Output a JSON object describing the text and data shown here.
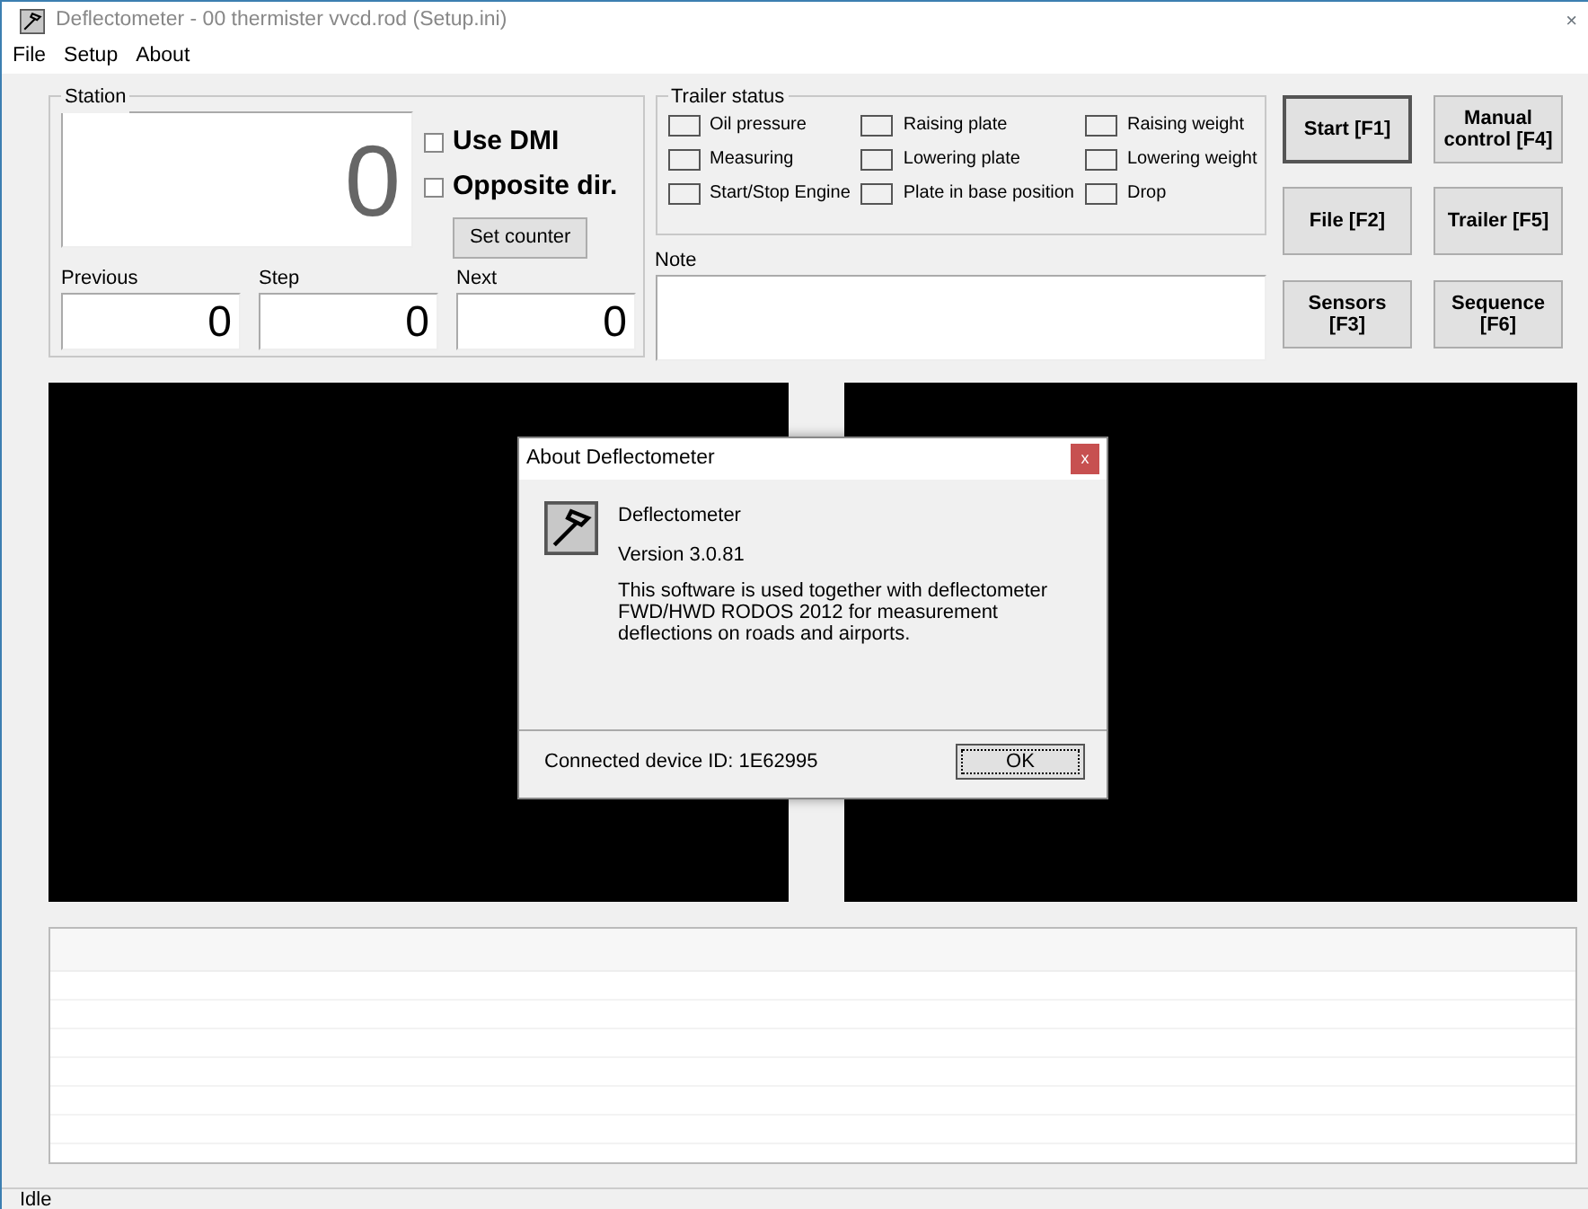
{
  "window": {
    "title": "Deflectometer - 00 thermister vvcd.rod (Setup.ini)",
    "close": "×"
  },
  "menu": [
    "File",
    "Setup",
    "About"
  ],
  "station": {
    "label": "Station",
    "value": "0",
    "options": [
      {
        "label": "Use DMI",
        "checked": false
      },
      {
        "label": "Opposite dir.",
        "checked": false
      }
    ],
    "set_button": "Set counter",
    "counters": [
      {
        "label": "Previous",
        "value": "0"
      },
      {
        "label": "Step",
        "value": "0"
      },
      {
        "label": "Next",
        "value": "0"
      }
    ]
  },
  "trailer_status": {
    "label": "Trailer status",
    "items": [
      {
        "label": "Oil pressure",
        "on": false
      },
      {
        "label": "Raising plate",
        "on": false
      },
      {
        "label": "Raising weight",
        "on": false
      },
      {
        "label": "Measuring",
        "on": false
      },
      {
        "label": "Lowering plate",
        "on": false
      },
      {
        "label": "Lowering weight",
        "on": false
      },
      {
        "label": "Start/Stop Engine",
        "on": false
      },
      {
        "label": "Plate in base position",
        "on": false
      },
      {
        "label": "Drop",
        "on": false
      }
    ]
  },
  "note": {
    "label": "Note"
  },
  "buttons": [
    {
      "label": "Start [F1]",
      "focused": true
    },
    {
      "label": "Manual control [F4]",
      "focused": false
    },
    {
      "label": "File [F2]",
      "focused": false
    },
    {
      "label": "Trailer [F5]",
      "focused": false
    },
    {
      "label": "Sensors [F3]",
      "focused": false
    },
    {
      "label": "Sequence [F6]",
      "focused": false
    }
  ],
  "dialog": {
    "title": "About Deflectometer",
    "close": "x",
    "app_name": "Deflectometer",
    "version": "Version 3.0.81",
    "description": "This software is used together with deflectometer FWD/HWD RODOS 2012 for measurement deflections on roads and airports.",
    "device": "Connected device ID: 1E62995",
    "ok": "OK"
  },
  "status_bar": "Idle"
}
